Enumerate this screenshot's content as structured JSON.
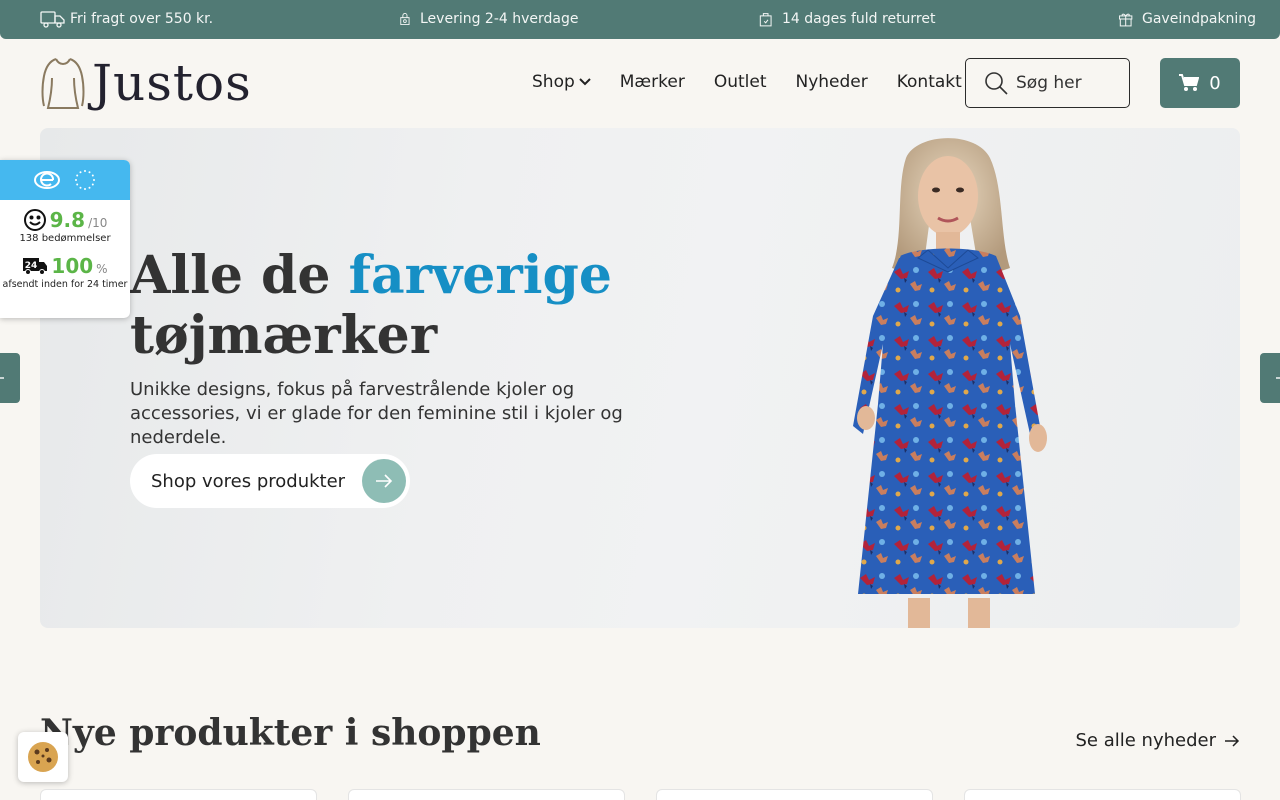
{
  "topbar": {
    "items": [
      {
        "icon": "truck-icon",
        "label": "Fri fragt over 550 kr."
      },
      {
        "icon": "package-icon",
        "label": "Levering 2-4 hverdage"
      },
      {
        "icon": "return-bag-icon",
        "label": "14 dages fuld returret"
      },
      {
        "icon": "gift-icon",
        "label": "Gaveindpakning"
      }
    ]
  },
  "header": {
    "logo_text": "Justos",
    "nav": [
      {
        "label": "Shop",
        "has_dropdown": true
      },
      {
        "label": "Mærker"
      },
      {
        "label": "Outlet"
      },
      {
        "label": "Nyheder"
      },
      {
        "label": "Kontakt"
      }
    ],
    "search_placeholder": "Søg her",
    "cart_count": "0"
  },
  "hero": {
    "title_start": "Alle de ",
    "title_accent": "farverige",
    "title_end": "tøjmærker",
    "subtitle": "Unikke designs, fokus på farvestrålende kjoler og accessories, vi er glade for den feminine stil i kjoler og nederdele.",
    "cta_label": "Shop vores produkter"
  },
  "trust": {
    "score": "9.8",
    "score_denominator": "/10",
    "reviews_label": "138 bedømmelser",
    "shipping_score": "100",
    "shipping_unit": "%",
    "shipping_label": "afsendt inden for 24 timer",
    "badge_24": "24"
  },
  "section": {
    "title": "Nye produkter i shoppen",
    "see_all": "Se alle nyheder"
  },
  "colors": {
    "brand": "#517a75",
    "accent_blue": "#168fc5",
    "score_green": "#5bb547",
    "trust_blue": "#45b8ef"
  }
}
